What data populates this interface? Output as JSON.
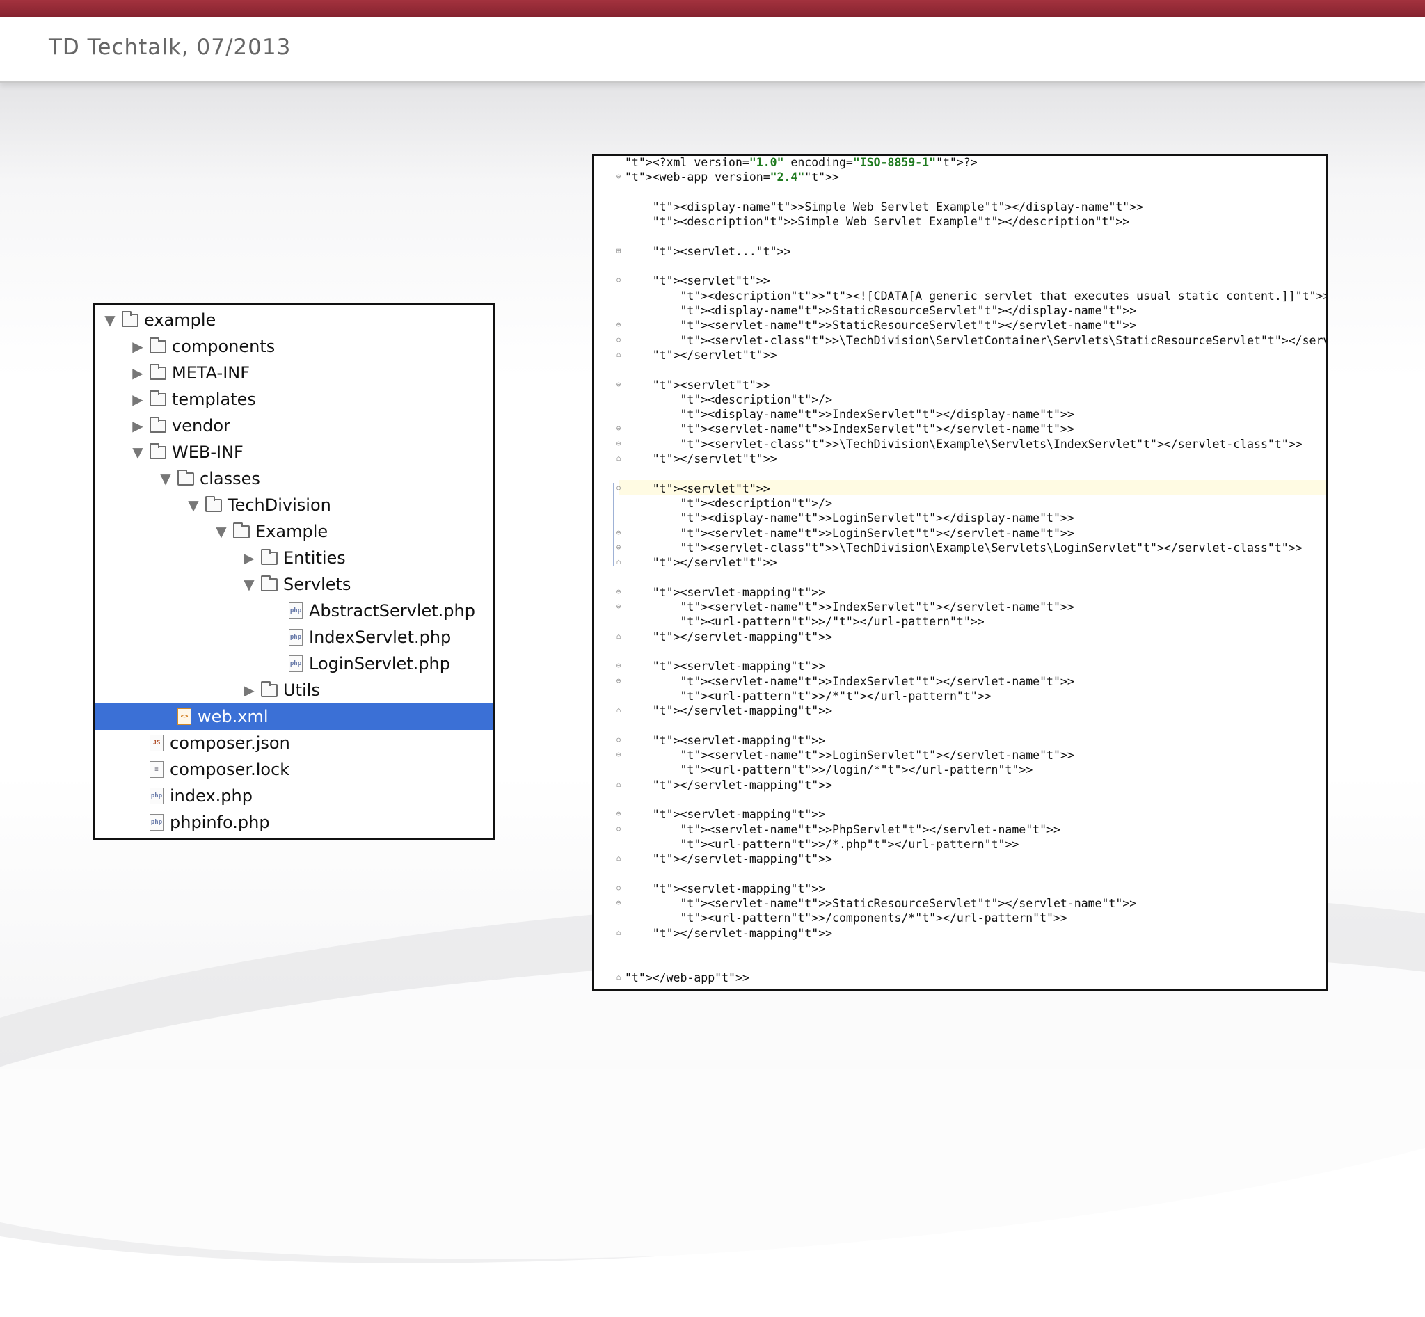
{
  "header": {
    "title": "TD Techtalk, 07/2013"
  },
  "tree": {
    "items": [
      {
        "label": "example",
        "type": "folder",
        "depth": 0,
        "expanded": true
      },
      {
        "label": "components",
        "type": "folder",
        "depth": 1,
        "expanded": false
      },
      {
        "label": "META-INF",
        "type": "folder",
        "depth": 1,
        "expanded": false
      },
      {
        "label": "templates",
        "type": "folder",
        "depth": 1,
        "expanded": false
      },
      {
        "label": "vendor",
        "type": "folder",
        "depth": 1,
        "expanded": false
      },
      {
        "label": "WEB-INF",
        "type": "folder",
        "depth": 1,
        "expanded": true
      },
      {
        "label": "classes",
        "type": "folder",
        "depth": 2,
        "expanded": true
      },
      {
        "label": "TechDivision",
        "type": "folder",
        "depth": 3,
        "expanded": true
      },
      {
        "label": "Example",
        "type": "folder",
        "depth": 4,
        "expanded": true
      },
      {
        "label": "Entities",
        "type": "folder",
        "depth": 5,
        "expanded": false
      },
      {
        "label": "Servlets",
        "type": "folder",
        "depth": 5,
        "expanded": true
      },
      {
        "label": "AbstractServlet.php",
        "type": "php",
        "depth": 6
      },
      {
        "label": "IndexServlet.php",
        "type": "php",
        "depth": 6
      },
      {
        "label": "LoginServlet.php",
        "type": "php",
        "depth": 6
      },
      {
        "label": "Utils",
        "type": "folder",
        "depth": 5,
        "expanded": false
      },
      {
        "label": "web.xml",
        "type": "xml",
        "depth": 2,
        "selected": true
      },
      {
        "label": "composer.json",
        "type": "json",
        "depth": 1
      },
      {
        "label": "composer.lock",
        "type": "text",
        "depth": 1
      },
      {
        "label": "index.php",
        "type": "php",
        "depth": 1
      },
      {
        "label": "phpinfo.php",
        "type": "php",
        "depth": 1
      }
    ]
  },
  "code": {
    "lines": [
      "<?xml version=\"1.0\" encoding=\"ISO-8859-1\"?>",
      "<web-app version=\"2.4\">",
      "",
      "    <display-name>Simple Web Servlet Example</display-name>",
      "    <description>Simple Web Servlet Example</description>",
      "",
      "    <servlet...>",
      "",
      "    <servlet>",
      "        <description><![CDATA[A generic servlet that executes usual static content.]]></description>",
      "        <display-name>StaticResourceServlet</display-name>",
      "        <servlet-name>StaticResourceServlet</servlet-name>",
      "        <servlet-class>\\TechDivision\\ServletContainer\\Servlets\\StaticResourceServlet</servlet-class>",
      "    </servlet>",
      "",
      "    <servlet>",
      "        <description/>",
      "        <display-name>IndexServlet</display-name>",
      "        <servlet-name>IndexServlet</servlet-name>",
      "        <servlet-class>\\TechDivision\\Example\\Servlets\\IndexServlet</servlet-class>",
      "    </servlet>",
      "",
      "    <servlet>",
      "        <description/>",
      "        <display-name>LoginServlet</display-name>",
      "        <servlet-name>LoginServlet</servlet-name>",
      "        <servlet-class>\\TechDivision\\Example\\Servlets\\LoginServlet</servlet-class>",
      "    </servlet>",
      "",
      "    <servlet-mapping>",
      "        <servlet-name>IndexServlet</servlet-name>",
      "        <url-pattern>/</url-pattern>",
      "    </servlet-mapping>",
      "",
      "    <servlet-mapping>",
      "        <servlet-name>IndexServlet</servlet-name>",
      "        <url-pattern>/*</url-pattern>",
      "    </servlet-mapping>",
      "",
      "    <servlet-mapping>",
      "        <servlet-name>LoginServlet</servlet-name>",
      "        <url-pattern>/login/*</url-pattern>",
      "    </servlet-mapping>",
      "",
      "    <servlet-mapping>",
      "        <servlet-name>PhpServlet</servlet-name>",
      "        <url-pattern>/*.php</url-pattern>",
      "    </servlet-mapping>",
      "",
      "    <servlet-mapping>",
      "        <servlet-name>StaticResourceServlet</servlet-name>",
      "        <url-pattern>/components/*</url-pattern>",
      "    </servlet-mapping>",
      "",
      "",
      "</web-app>"
    ]
  }
}
